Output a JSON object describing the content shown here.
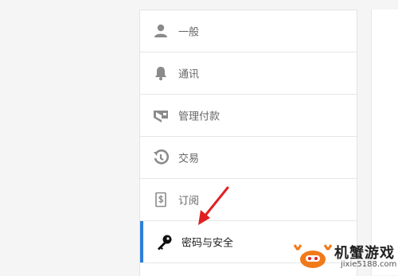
{
  "menu": {
    "items": [
      {
        "label": "一般",
        "icon": "person-icon"
      },
      {
        "label": "通讯",
        "icon": "bell-icon"
      },
      {
        "label": "管理付款",
        "icon": "wallet-icon"
      },
      {
        "label": "交易",
        "icon": "history-icon"
      },
      {
        "label": "订阅",
        "icon": "receipt-dollar-icon"
      },
      {
        "label": "密码与安全",
        "icon": "key-icon",
        "active": true
      }
    ]
  },
  "colors": {
    "accent": "#2d7fd6",
    "icon_gray": "#8a8a8a",
    "arrow_red": "#e02020"
  },
  "watermark": {
    "title": "机蟹游戏",
    "site": "jixie5188.com"
  }
}
